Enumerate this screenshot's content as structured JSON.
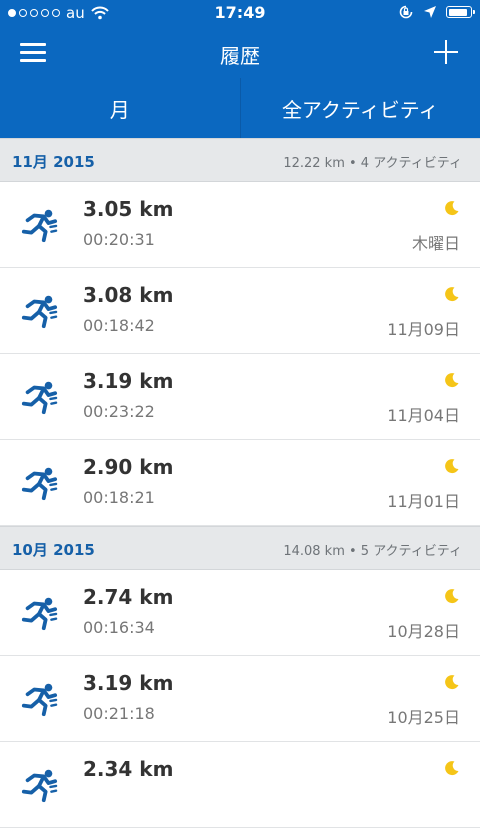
{
  "status_bar": {
    "carrier": "au",
    "time": "17:49",
    "signal_filled": 1,
    "signal_total": 5,
    "battery_level": 0.9
  },
  "nav": {
    "title": "履歴",
    "menu_icon": "hamburger-menu-icon",
    "add_icon": "plus-icon"
  },
  "tabs": [
    {
      "label": "月"
    },
    {
      "label": "全アクティビティ"
    }
  ],
  "colors": {
    "brand_blue": "#0b68c0",
    "run_icon": "#1660a8",
    "moon": "#f5c518",
    "section_bg": "#e6e8ea"
  },
  "sections": [
    {
      "month": "11月 2015",
      "summary": "12.22 km • 4 アクティビティ",
      "activities": [
        {
          "distance": "3.05 km",
          "duration": "00:20:31",
          "date": "木曜日"
        },
        {
          "distance": "3.08 km",
          "duration": "00:18:42",
          "date": "11月09日"
        },
        {
          "distance": "3.19 km",
          "duration": "00:23:22",
          "date": "11月04日"
        },
        {
          "distance": "2.90 km",
          "duration": "00:18:21",
          "date": "11月01日"
        }
      ]
    },
    {
      "month": "10月 2015",
      "summary": "14.08 km • 5 アクティビティ",
      "activities": [
        {
          "distance": "2.74 km",
          "duration": "00:16:34",
          "date": "10月28日"
        },
        {
          "distance": "3.19 km",
          "duration": "00:21:18",
          "date": "10月25日"
        },
        {
          "distance": "2.34 km",
          "duration": "",
          "date": ""
        }
      ]
    }
  ]
}
